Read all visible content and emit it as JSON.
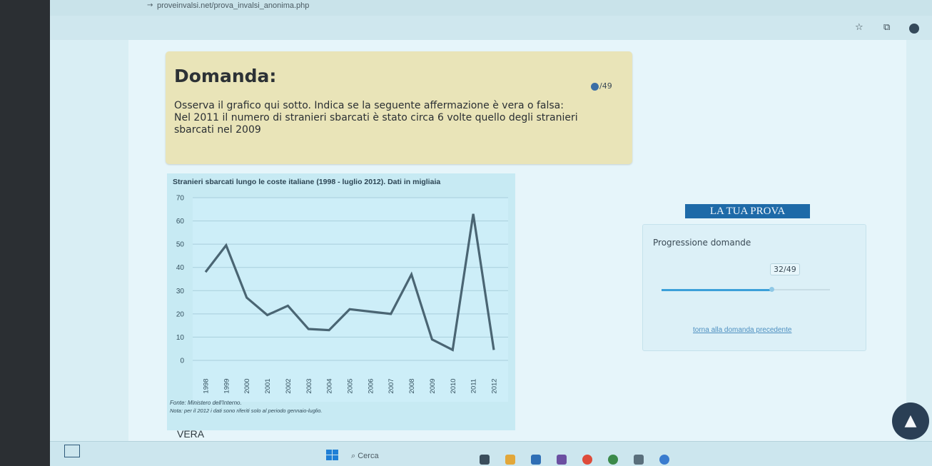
{
  "browser": {
    "url": "proveinvalsi.net/prova_invalsi_anonima.php",
    "icons": [
      "url-arrow-icon",
      "star-icon",
      "extensions-icon",
      "profile-avatar"
    ]
  },
  "question": {
    "title": "Domanda:",
    "counter_current": "32",
    "counter_total": "/49",
    "text_line1": "Osserva il grafico qui sotto. Indica se la seguente affermazione è vera o falsa:",
    "text_line2": "Nel 2011 il numero di stranieri sbarcati è stato circa 6 volte quello degli stranieri sbarcati nel 2009"
  },
  "chart_data": {
    "type": "line",
    "title": "Stranieri sbarcati lungo le coste italiane (1998 - luglio 2012). Dati in migliaia",
    "x": [
      "1998",
      "1999",
      "2000",
      "2001",
      "2002",
      "2003",
      "2004",
      "2005",
      "2006",
      "2007",
      "2008",
      "2009",
      "2010",
      "2011",
      "2012"
    ],
    "values": [
      38,
      49.5,
      27,
      19.5,
      23.5,
      13.5,
      13,
      22,
      21,
      20,
      37,
      9,
      4.5,
      63,
      4.5
    ],
    "ylim": [
      0,
      70
    ],
    "yticks": [
      0,
      10,
      20,
      30,
      40,
      50,
      60,
      70
    ],
    "grid": true,
    "line_color": "#4a6573",
    "source": "Fonte: Ministero dell'Interno.",
    "note": "Nota: per il 2012 i dati sono riferiti solo al periodo gennaio-luglio."
  },
  "answer": "VERA",
  "sidebar": {
    "banner": "LA TUA PROVA",
    "progress_label": "Progressione domande",
    "progress_count": "32/49",
    "progress_fraction": 0.653,
    "prev_link": "torna alla domanda precedente"
  },
  "taskbar": {
    "search_placeholder": "Cerca"
  },
  "colors": {
    "question_bg": "#e9e4b8",
    "accent": "#1e6aa8",
    "chart_bg": "#c7eaf3"
  }
}
